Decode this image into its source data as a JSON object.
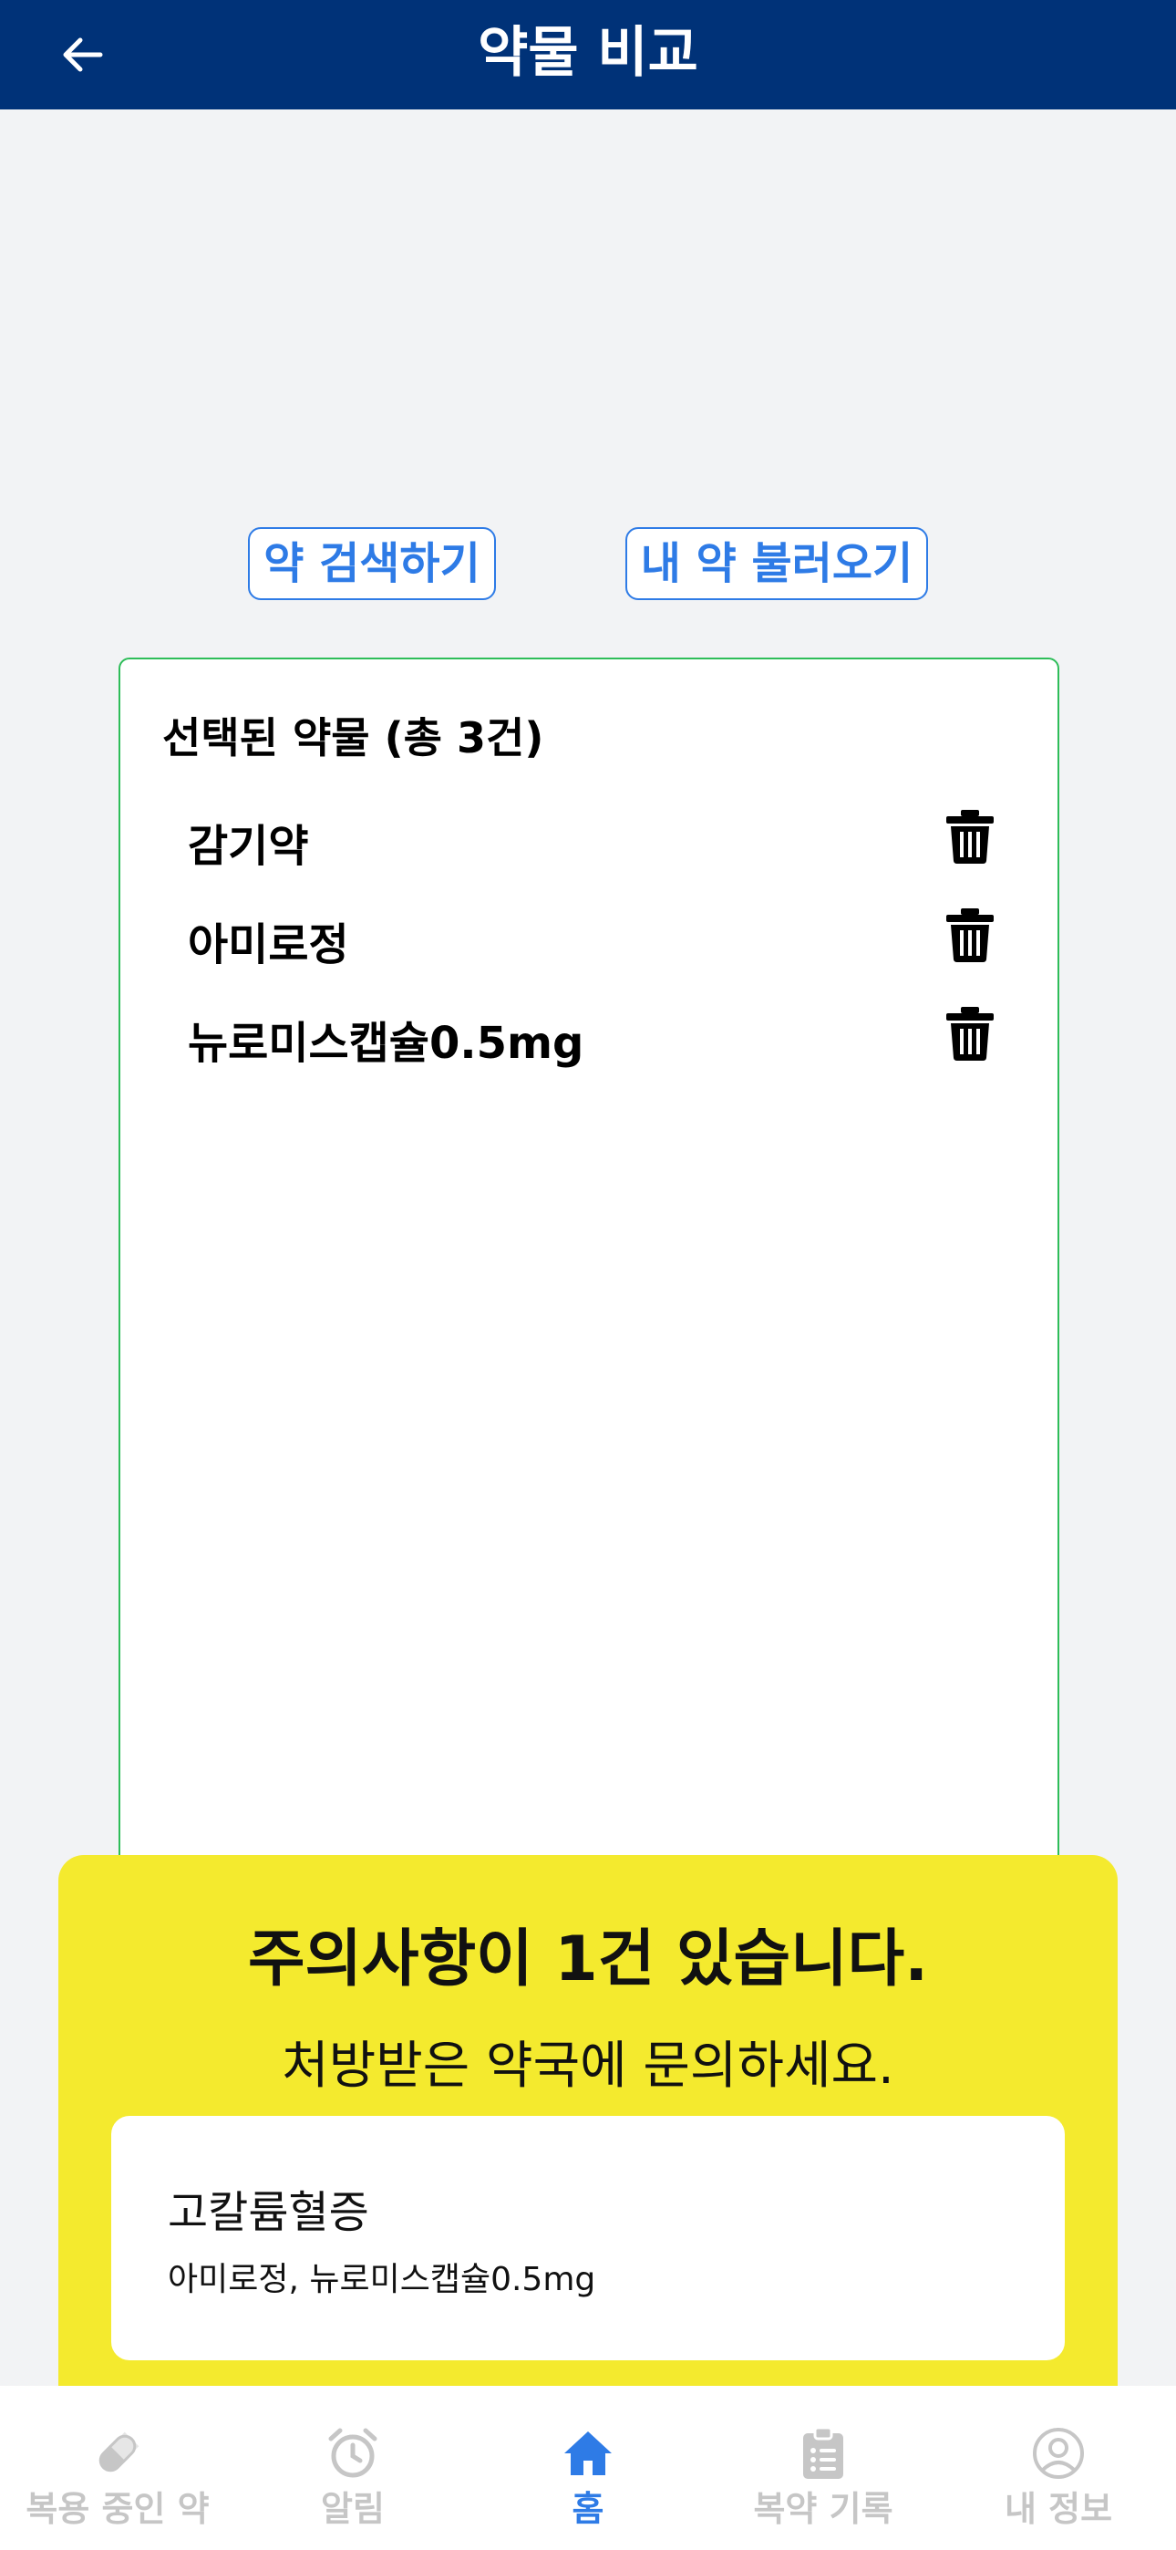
{
  "header": {
    "title": "약물 비교"
  },
  "actions": {
    "search_label": "약 검색하기",
    "load_label": "내 약 불러오기"
  },
  "selected": {
    "title": "선택된 약물 (총 3건)",
    "items": [
      {
        "name": "감기약"
      },
      {
        "name": "아미로정"
      },
      {
        "name": "뉴로미스캡슐0.5mg"
      }
    ]
  },
  "warning": {
    "title": "주의사항이 1건 있습니다.",
    "subtitle": "처방받은 약국에 문의하세요.",
    "items": [
      {
        "title": "고칼륨혈증",
        "detail": "아미로정, 뉴로미스캡슐0.5mg"
      }
    ]
  },
  "nav": {
    "items": [
      {
        "label": "복용 중인 약",
        "icon": "pill-icon",
        "active": false
      },
      {
        "label": "알림",
        "icon": "alarm-icon",
        "active": false
      },
      {
        "label": "홈",
        "icon": "home-icon",
        "active": true
      },
      {
        "label": "복약 기록",
        "icon": "clipboard-icon",
        "active": false
      },
      {
        "label": "내 정보",
        "icon": "user-icon",
        "active": false
      }
    ]
  },
  "colors": {
    "header_bg": "#003278",
    "accent": "#2e7be6",
    "panel_border": "#2ebd59",
    "warning_bg": "#f4ea2e",
    "nav_inactive": "#c6c6c6"
  }
}
